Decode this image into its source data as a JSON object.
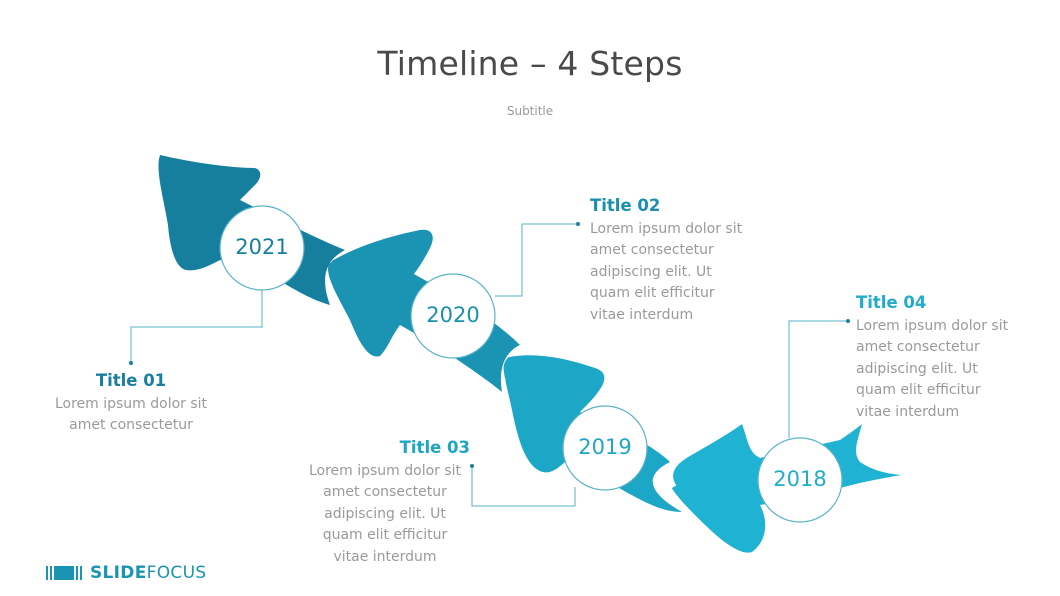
{
  "header": {
    "title": "Timeline – 4 Steps",
    "subtitle": "Subtitle"
  },
  "colors": {
    "arrow_2021": "#167f9e",
    "arrow_2020": "#1a94b2",
    "arrow_2019": "#1da7c6",
    "arrow_2018": "#20b2d2",
    "text_gray": "#9a9a9a",
    "title_gray": "#4a4a4a"
  },
  "steps": [
    {
      "year": "2021",
      "title": "Title 01",
      "body_lines": [
        "Lorem ipsum dolor sit",
        "amet consectetur"
      ],
      "color": "#167f9e"
    },
    {
      "year": "2020",
      "title": "Title 02",
      "body_lines": [
        "Lorem ipsum dolor sit",
        "amet consectetur",
        "adipiscing elit. Ut",
        "quam elit efficitur",
        "vitae  interdum"
      ],
      "color": "#1a8fae"
    },
    {
      "year": "2019",
      "title": "Title 03",
      "body_lines": [
        "Lorem ipsum dolor sit",
        "amet consectetur",
        "adipiscing elit. Ut",
        "quam elit efficitur",
        "vitae  interdum"
      ],
      "color": "#1fa6c5"
    },
    {
      "year": "2018",
      "title": "Title 04",
      "body_lines": [
        "Lorem ipsum dolor sit",
        "amet consectetur",
        "adipiscing elit. Ut",
        "quam elit efficitur",
        "vitae  interdum"
      ],
      "color": "#20acca"
    }
  ],
  "logo": {
    "bold": "SLIDE",
    "light": "FOCUS",
    "icon": "film-strip-icon"
  }
}
